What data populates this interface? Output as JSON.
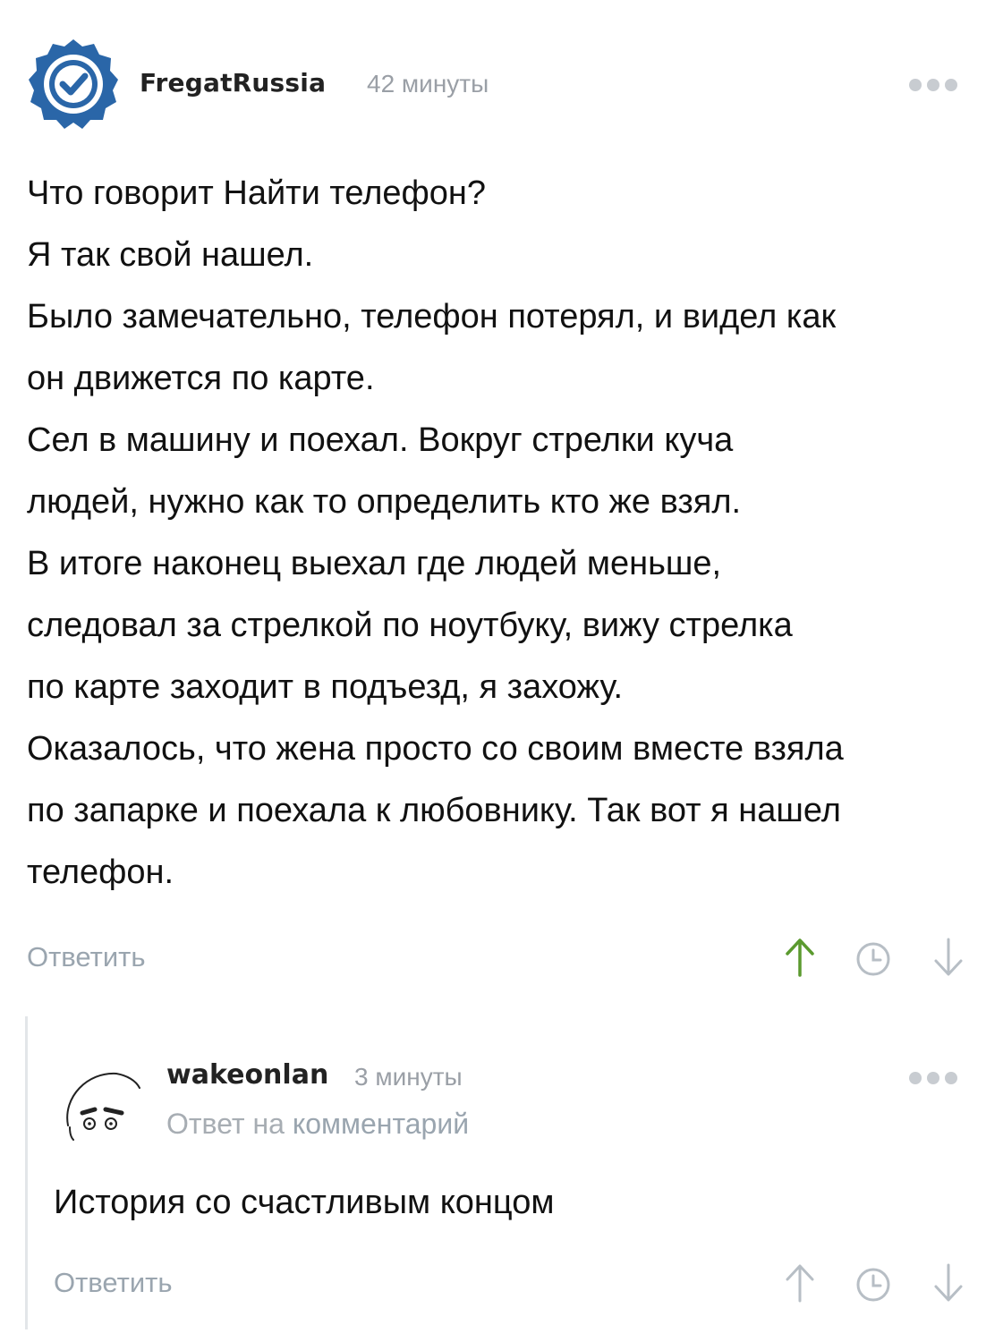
{
  "comments": [
    {
      "author": "FregatRussia",
      "time": "42 минуты",
      "avatar": "verified-check-badge-icon",
      "body": [
        "Что говорит Найти телефон?",
        "Я так свой нашел.",
        "Было замечательно, телефон потерял, и видел как",
        "он движется по карте.",
        "Сел в машину и поехал. Вокруг стрелки куча",
        "людей, нужно как то определить кто же взял.",
        "В итоге наконец выехал где людей меньше,",
        "следовал за стрелкой по ноутбуку, вижу стрелка",
        "по карте заходит в подъезд, я захожу.",
        "Оказалось, что жена просто со своим вместе взяла",
        "по запарке и поехала к любовнику. Так вот я нашел",
        "телефон."
      ],
      "reply_label": "Ответить",
      "upvote_state": "active"
    },
    {
      "author": "wakeonlan",
      "time": "3 минуты",
      "avatar": "sketch-face-avatar",
      "reply_prefix": "Ответ на",
      "reply_target": "комментарий",
      "body": "История со счастливым концом",
      "reply_label": "Ответить",
      "upvote_state": "neutral"
    }
  ],
  "colors": {
    "upvote_active": "#5b9a2f",
    "icon_neutral": "#b7bec5",
    "badge_blue": "#2a66a8",
    "muted_text": "#9aa5af"
  }
}
